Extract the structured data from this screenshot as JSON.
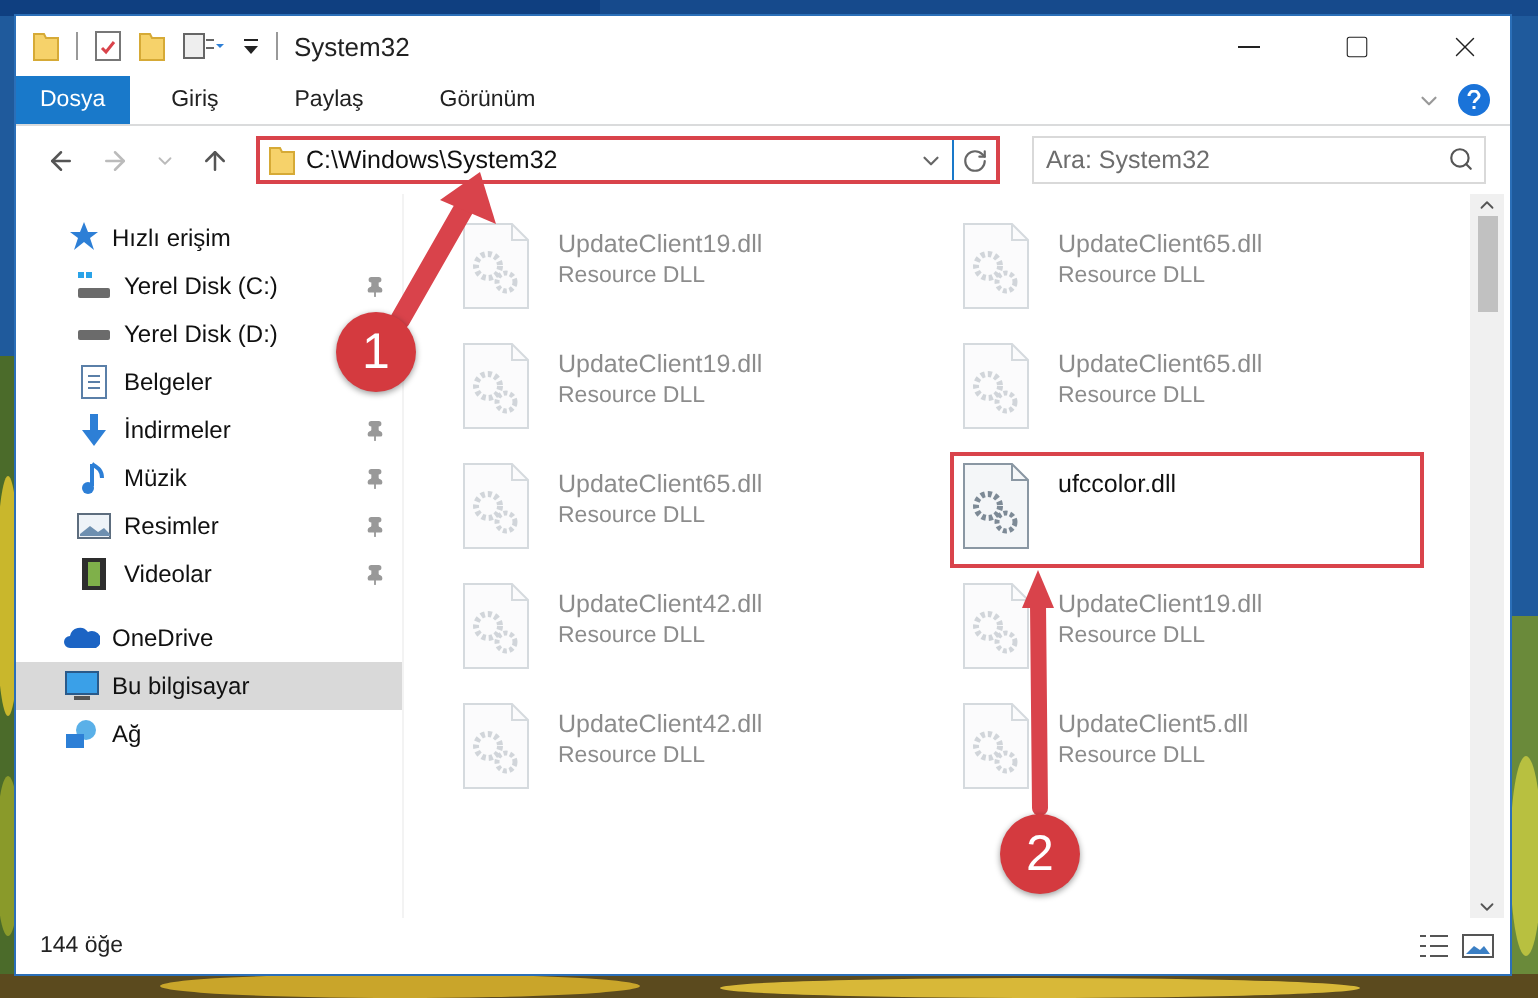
{
  "window": {
    "title": "System32"
  },
  "ribbon_tabs": [
    {
      "label": "Dosya",
      "selected": true
    },
    {
      "label": "Giriş",
      "selected": false
    },
    {
      "label": "Paylaş",
      "selected": false
    },
    {
      "label": "Görünüm",
      "selected": false
    }
  ],
  "address_bar": {
    "path": "C:\\Windows\\System32",
    "highlighted": true
  },
  "search": {
    "placeholder": "Ara: System32"
  },
  "sidebar": {
    "items": [
      {
        "label": "Hızlı erişim",
        "kind": "quick-access",
        "selected": false,
        "children": [
          {
            "label": "Yerel Disk (C:)",
            "kind": "system-drive",
            "selected": false,
            "pinned": true
          },
          {
            "label": "Yerel Disk (D:)",
            "kind": "drive",
            "selected": false,
            "pinned": false
          },
          {
            "label": "Belgeler",
            "kind": "documents",
            "selected": false,
            "pinned": false
          },
          {
            "label": "İndirmeler",
            "kind": "downloads",
            "selected": false,
            "pinned": true
          },
          {
            "label": "Müzik",
            "kind": "music",
            "selected": false,
            "pinned": true
          },
          {
            "label": "Resimler",
            "kind": "pictures",
            "selected": false,
            "pinned": true
          },
          {
            "label": "Videolar",
            "kind": "videos",
            "selected": false,
            "pinned": true
          }
        ]
      },
      {
        "label": "OneDrive",
        "kind": "cloud",
        "selected": false
      },
      {
        "label": "Bu bilgisayar",
        "kind": "computer",
        "selected": true
      },
      {
        "label": "Ağ",
        "kind": "network",
        "selected": false
      }
    ]
  },
  "files": [
    {
      "name": "UpdateClient19.dll",
      "type": "Resource DLL",
      "highlighted": false
    },
    {
      "name": "UpdateClient65.dll",
      "type": "Resource DLL",
      "highlighted": false
    },
    {
      "name": "UpdateClient19.dll",
      "type": "Resource DLL",
      "highlighted": false
    },
    {
      "name": "UpdateClient65.dll",
      "type": "Resource DLL",
      "highlighted": false
    },
    {
      "name": "UpdateClient65.dll",
      "type": "Resource DLL",
      "highlighted": false
    },
    {
      "name": "ufccolor.dll",
      "highlighted": true
    },
    {
      "name": "UpdateClient42.dll",
      "type": "Resource DLL",
      "highlighted": false
    },
    {
      "name": "UpdateClient19.dll",
      "type": "Resource DLL",
      "highlighted": false
    },
    {
      "name": "UpdateClient42.dll",
      "type": "Resource DLL",
      "highlighted": false
    },
    {
      "name": "UpdateClient5.dll",
      "type": "Resource DLL",
      "highlighted": false
    }
  ],
  "annotations": [
    {
      "label": "1"
    },
    {
      "label": "2"
    }
  ],
  "status_bar": {
    "item_count": "144 öğe"
  }
}
